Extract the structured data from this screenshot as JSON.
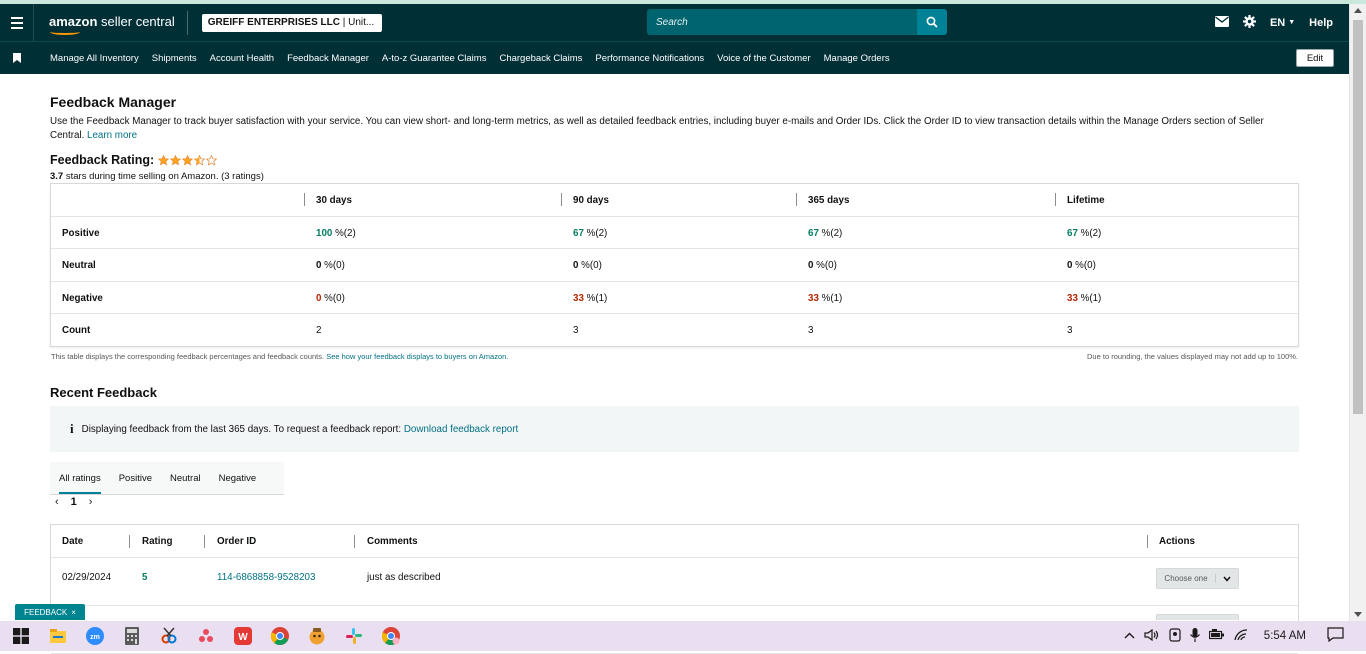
{
  "header": {
    "logo_bold": "amazon",
    "logo_rest": " seller central",
    "account_name": "GREIFF ENTERPRISES LLC",
    "account_region": " | Unit...",
    "search_placeholder": "Search",
    "language": "EN",
    "help": "Help"
  },
  "nav": {
    "items": [
      "Manage All Inventory",
      "Shipments",
      "Account Health",
      "Feedback Manager",
      "A-to-z Guarantee Claims",
      "Chargeback Claims",
      "Performance Notifications",
      "Voice of the Customer",
      "Manage Orders"
    ],
    "edit_label": "Edit"
  },
  "page": {
    "title": "Feedback Manager",
    "intro": "Use the Feedback Manager to track buyer satisfaction with your service. You can view short- and long-term metrics, as well as detailed feedback entries, including buyer e-mails and Order IDs. Click the Order ID to view transaction details within the Manage Orders section of Seller Central. ",
    "learn_more": "Learn more",
    "rating_label": "Feedback Rating:",
    "rating_stars": 3.5,
    "rating_value": "3.7",
    "rating_sub": " stars during time selling on Amazon. (3 ratings)"
  },
  "summary_table": {
    "columns": [
      "30 days",
      "90 days",
      "365 days",
      "Lifetime"
    ],
    "rows": [
      {
        "label": "Positive",
        "cells": [
          {
            "v": "100",
            "s": " %(2)"
          },
          {
            "v": "67",
            "s": " %(2)"
          },
          {
            "v": "67",
            "s": " %(2)"
          },
          {
            "v": "67",
            "s": " %(2)"
          }
        ]
      },
      {
        "label": "Neutral",
        "cells": [
          {
            "v": "0",
            "s": " %(0)"
          },
          {
            "v": "0",
            "s": " %(0)"
          },
          {
            "v": "0",
            "s": " %(0)"
          },
          {
            "v": "0",
            "s": " %(0)"
          }
        ]
      },
      {
        "label": "Negative",
        "cells": [
          {
            "v": "0",
            "s": " %(0)"
          },
          {
            "v": "33",
            "s": " %(1)"
          },
          {
            "v": "33",
            "s": " %(1)"
          },
          {
            "v": "33",
            "s": " %(1)"
          }
        ]
      },
      {
        "label": "Count",
        "cells": [
          {
            "v": "2",
            "s": ""
          },
          {
            "v": "3",
            "s": ""
          },
          {
            "v": "3",
            "s": ""
          },
          {
            "v": "3",
            "s": ""
          }
        ]
      }
    ],
    "note_left": "This table displays the corresponding feedback percentages and feedback counts. ",
    "note_link": "See how your feedback displays to buyers on Amazon.",
    "note_right": "Due to rounding, the values displayed may not add up to 100%."
  },
  "recent": {
    "title": "Recent Feedback",
    "info_text": "Displaying feedback from the last 365 days. To request a feedback report: ",
    "info_link": "Download feedback report",
    "tabs": [
      "All ratings",
      "Positive",
      "Neutral",
      "Negative"
    ],
    "page_number": "1",
    "columns": [
      "Date",
      "Rating",
      "Order ID",
      "Comments",
      "Actions"
    ],
    "rows": [
      {
        "date": "02/29/2024",
        "rating": "5",
        "order_id": "114-6868858-9528203",
        "comment": "just as described",
        "action": "Choose one"
      }
    ]
  },
  "feedback_tab": "FEEDBACK",
  "taskbar": {
    "time": "5:54 AM"
  },
  "colors": {
    "header_bg": "#002f36",
    "positive": "#067d62",
    "negative": "#b12704",
    "link": "#007185",
    "star": "#ffa41c"
  }
}
